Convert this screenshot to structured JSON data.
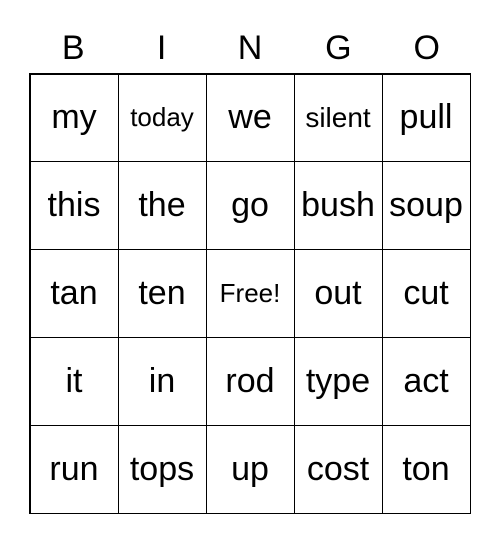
{
  "header": [
    "B",
    "I",
    "N",
    "G",
    "O"
  ],
  "cells": [
    "my",
    "today",
    "we",
    "silent",
    "pull",
    "this",
    "the",
    "go",
    "bush",
    "soup",
    "tan",
    "ten",
    "Free!",
    "out",
    "cut",
    "it",
    "in",
    "rod",
    "type",
    "act",
    "run",
    "tops",
    "up",
    "cost",
    "ton"
  ]
}
